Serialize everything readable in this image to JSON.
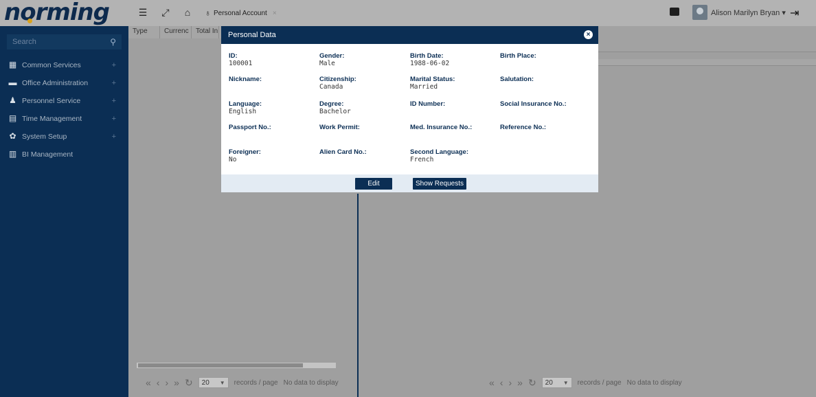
{
  "app": {
    "logo_text": "norming"
  },
  "topbar": {
    "tab_label": "Personal Account",
    "tab_close": "×",
    "user_name": "Alison Marilyn Bryan ▾"
  },
  "sidebar": {
    "search_placeholder": "Search",
    "items": [
      {
        "label": "Common Services",
        "icon": "grid-icon",
        "plus": "+"
      },
      {
        "label": "Office Administration",
        "icon": "briefcase-icon",
        "plus": "+"
      },
      {
        "label": "Personnel Service",
        "icon": "people-icon",
        "plus": "+"
      },
      {
        "label": "Time Management",
        "icon": "calendar-icon",
        "plus": "+"
      },
      {
        "label": "System Setup",
        "icon": "gear-icon",
        "plus": "+"
      },
      {
        "label": "BI Management",
        "icon": "report-icon",
        "plus": ""
      }
    ]
  },
  "grid": {
    "headers": [
      "Type",
      "Currenc",
      "Total In"
    ]
  },
  "pager_left": {
    "page_size": "20",
    "records_label": "records / page",
    "status": "No data to display"
  },
  "pager_right": {
    "page_size": "20",
    "records_label": "records / page",
    "status": "No data to display"
  },
  "dialog": {
    "title": "Personal Data",
    "fields": [
      {
        "label": "ID:",
        "value": "100001"
      },
      {
        "label": "Gender:",
        "value": "Male"
      },
      {
        "label": "Birth Date:",
        "value": "1988-06-02"
      },
      {
        "label": "Birth Place:",
        "value": ""
      },
      {
        "label": "Nickname:",
        "value": ""
      },
      {
        "label": "Citizenship:",
        "value": "Canada"
      },
      {
        "label": "Marital Status:",
        "value": "Married"
      },
      {
        "label": "Salutation:",
        "value": ""
      },
      {
        "label": "Language:",
        "value": "English"
      },
      {
        "label": "Degree:",
        "value": "Bachelor"
      },
      {
        "label": "ID Number:",
        "value": ""
      },
      {
        "label": "Social Insurance No.:",
        "value": ""
      },
      {
        "label": "Passport No.:",
        "value": ""
      },
      {
        "label": "Work Permit:",
        "value": ""
      },
      {
        "label": "Med. Insurance No.:",
        "value": ""
      },
      {
        "label": "Reference No.:",
        "value": ""
      },
      {
        "label": "Foreigner:",
        "value": "No"
      },
      {
        "label": "Alien Card No.:",
        "value": ""
      },
      {
        "label": "Second Language:",
        "value": "French"
      }
    ],
    "edit_label": "Edit",
    "show_requests_label": "Show Requests"
  }
}
